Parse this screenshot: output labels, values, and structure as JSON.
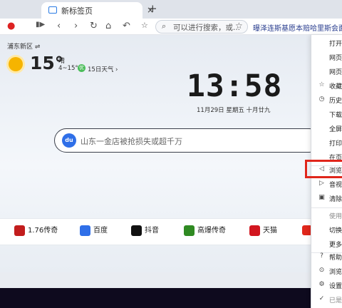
{
  "tab": {
    "title": "新标签页",
    "close": "×",
    "new": "+"
  },
  "toolbar": {
    "back": "‹",
    "forward": "›",
    "reload": "↻",
    "home": "⌂",
    "undo": "↶",
    "address_placeholder": "可以进行搜索，或...",
    "news": "曝泽连斯基愿本赔哈里斯会面"
  },
  "weather": {
    "location": "浦东新区 ⇌",
    "temp": "15°",
    "condition": "晴",
    "range": "4~15°",
    "aqi": "优",
    "forecast": "15日天气 ›"
  },
  "clock": {
    "time": "13:58",
    "date": "11月29日  星期五  十月廿九"
  },
  "search": {
    "placeholder": "山东一金店被抢损失或超千万",
    "engine": "du"
  },
  "shortcuts": [
    {
      "label": "1.76传奇",
      "color": "#c21d1d"
    },
    {
      "label": "百度",
      "color": "#2f6fe8"
    },
    {
      "label": "抖音",
      "color": "#111111"
    },
    {
      "label": "高爆传奇",
      "color": "#2f8a22"
    },
    {
      "label": "天猫",
      "color": "#d2161f"
    }
  ],
  "menu": {
    "items": [
      {
        "label": "打开新",
        "icon": ""
      },
      {
        "label": "网页无",
        "icon": ""
      },
      {
        "label": "网页保",
        "icon": ""
      },
      {
        "label": "收藏夹",
        "icon": "☆"
      },
      {
        "label": "历史记",
        "icon": "◷"
      },
      {
        "label": "下载管",
        "icon": ""
      },
      {
        "label": "全屏模",
        "icon": ""
      },
      {
        "label": "打印",
        "icon": ""
      },
      {
        "label": "在页面",
        "icon": ""
      },
      {
        "label": "浏览器",
        "icon": "◁"
      },
      {
        "label": "音视频",
        "icon": "▷"
      },
      {
        "label": "清除上",
        "icon": "▣"
      },
      {
        "label": "使用IE",
        "icon": ""
      },
      {
        "label": "切换到",
        "icon": ""
      },
      {
        "label": "更多工",
        "icon": ""
      },
      {
        "label": "帮助和",
        "icon": "?"
      },
      {
        "label": "浏览器",
        "icon": "⊙"
      },
      {
        "label": "设置",
        "icon": "⚙"
      },
      {
        "label": "已是最",
        "icon": "✓"
      }
    ]
  }
}
